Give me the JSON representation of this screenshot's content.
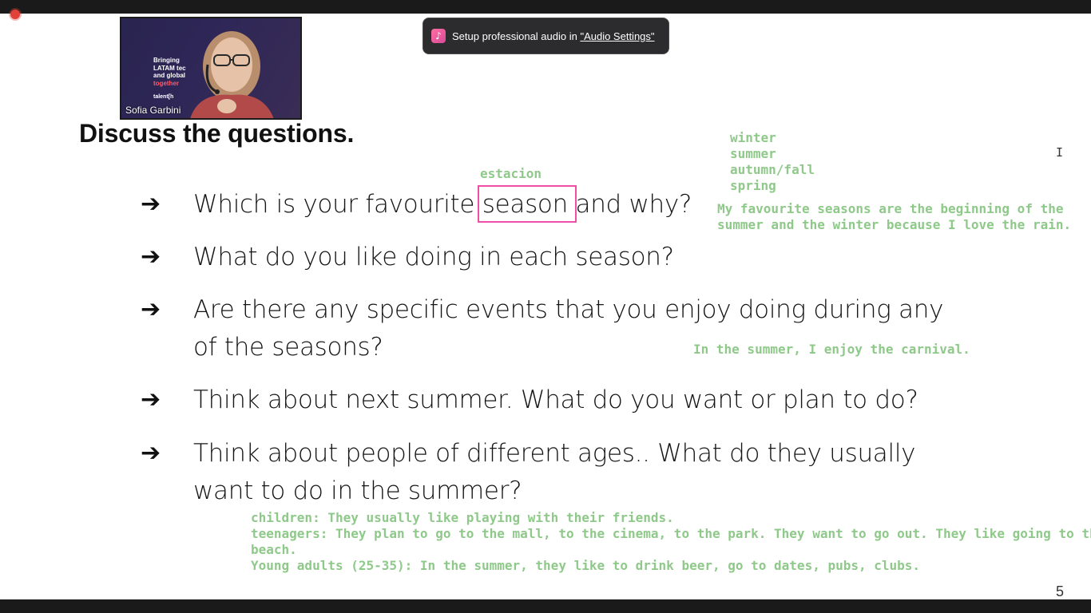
{
  "video": {
    "participant_name": "Sofia Garbini",
    "background_text": [
      "Bringing",
      "LATAM tec",
      "and global",
      "together"
    ],
    "background_logo": "talent[h"
  },
  "notification": {
    "text": "Setup professional audio in ",
    "link": "\"Audio Settings\""
  },
  "slide": {
    "title": "Discuss the questions.",
    "questions": [
      {
        "text_before": "Which is your favourite ",
        "highlight": "season",
        "text_after": " and why?"
      },
      {
        "line1": "What do you like doing in each season?"
      },
      {
        "line1": "Are there any specific events that you enjoy doing during any",
        "line2": "of the seasons?"
      },
      {
        "line1": "Think about next summer. What do you want or plan to do?"
      },
      {
        "line1": "Think about people of different ages.. What do they usually",
        "line2": "want to do in the summer?"
      }
    ],
    "slide_number": "5"
  },
  "annotations": {
    "translation": "estacion",
    "seasons_list": [
      "winter",
      "summer",
      "autumn/fall",
      "spring"
    ],
    "answer1": [
      "My favourite seasons are the beginning of the",
      "summer and the winter because I love the rain."
    ],
    "answer3": "In the summer, I enjoy the carnival.",
    "answer5": [
      "children: They usually like playing with their friends.",
      "teenagers: They plan to go to the mall, to the cinema, to the park. They want to go out. They like going to the",
      "beach.",
      "Young adults (25-35): In the summer, they like to drink beer, go to dates, pubs, clubs."
    ]
  },
  "colors": {
    "annotation": "#8fc98a",
    "highlight_box": "#f04fa8",
    "toast_bg": "#2c2c2e"
  }
}
